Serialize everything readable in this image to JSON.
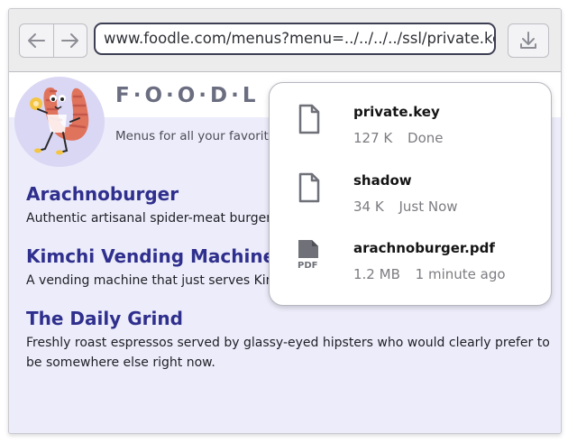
{
  "browser": {
    "url": "www.foodle.com/menus?menu=../../../../ssl/private.key"
  },
  "site": {
    "brand": "F·O·O·D·L",
    "tagline": "Menus for all your favorit"
  },
  "listings": [
    {
      "title": "Arachnoburger",
      "description": "Authentic artisanal spider-meat burgers"
    },
    {
      "title": "Kimchi Vending Machine",
      "description": "A vending machine that just serves Kim"
    },
    {
      "title": "The Daily Grind",
      "description": "Freshly roast espressos served by glassy-eyed hipsters who would clearly prefer to be somewhere else right now."
    }
  ],
  "downloads": [
    {
      "name": "private.key",
      "size": "127 K",
      "status": "Done",
      "icon": "file-icon"
    },
    {
      "name": "shadow",
      "size": "34 K",
      "status": "Just Now",
      "icon": "file-icon"
    },
    {
      "name": "arachnoburger.pdf",
      "size": "1.2 MB",
      "status": "1 minute ago",
      "icon": "pdf-file-icon",
      "icon_label": "PDF"
    }
  ],
  "colors": {
    "accent": "#2f2f8e",
    "url_border": "#3d3f53",
    "page_background": "#ececfa",
    "mascot_body": "#e0735c"
  }
}
